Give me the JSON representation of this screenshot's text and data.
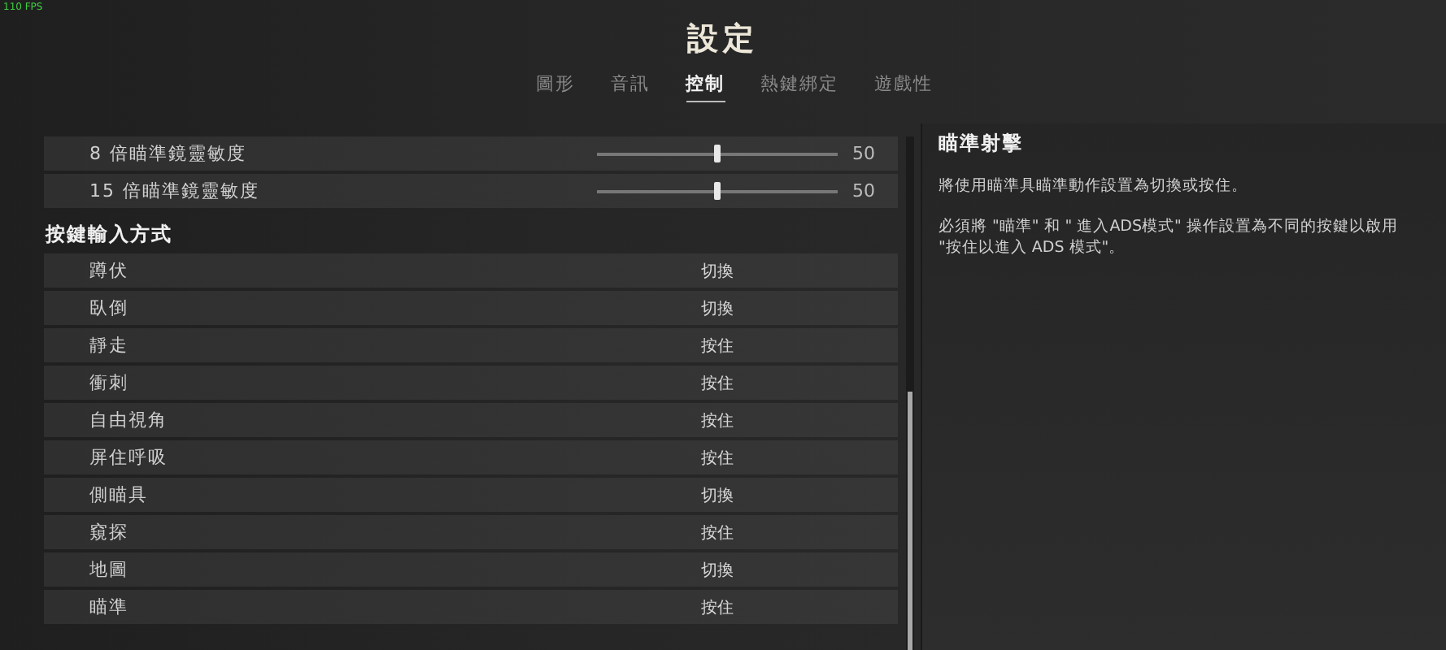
{
  "fps": "110 FPS",
  "title": "設定",
  "tabs": [
    {
      "label": "圖形",
      "selected": false
    },
    {
      "label": "音訊",
      "selected": false
    },
    {
      "label": "控制",
      "selected": true
    },
    {
      "label": "熱鍵綁定",
      "selected": false
    },
    {
      "label": "遊戲性",
      "selected": false
    }
  ],
  "sections": [
    {
      "rows": [
        {
          "kind": "slider",
          "label": "8 倍瞄準鏡靈敏度",
          "level": 0.5,
          "reading": "50"
        },
        {
          "kind": "slider",
          "label": "15 倍瞄準鏡靈敏度",
          "level": 0.5,
          "reading": "50"
        }
      ]
    },
    {
      "heading": "按鍵輸入方式",
      "rows": [
        {
          "kind": "option",
          "label": "蹲伏",
          "value": "切換"
        },
        {
          "kind": "option",
          "label": "臥倒",
          "value": "切換"
        },
        {
          "kind": "option",
          "label": "靜走",
          "value": "按住"
        },
        {
          "kind": "option",
          "label": "衝刺",
          "value": "按住"
        },
        {
          "kind": "option",
          "label": "自由視角",
          "value": "按住"
        },
        {
          "kind": "option",
          "label": "屏住呼吸",
          "value": "按住"
        },
        {
          "kind": "option",
          "label": "側瞄具",
          "value": "切換"
        },
        {
          "kind": "option",
          "label": "窺探",
          "value": "按住"
        },
        {
          "kind": "option",
          "label": "地圖",
          "value": "切換"
        },
        {
          "kind": "option",
          "label": "瞄準",
          "value": "按住"
        }
      ]
    }
  ],
  "detail": {
    "title": "瞄準射擊",
    "paragraphs": [
      "將使用瞄準具瞄準動作設置為切換或按住。",
      "必須將 \"瞄準\" 和 \" 進入ADS模式\" 操作設置為不同的按鍵以啟用 \"按住以進入 ADS 模式\"。"
    ]
  }
}
